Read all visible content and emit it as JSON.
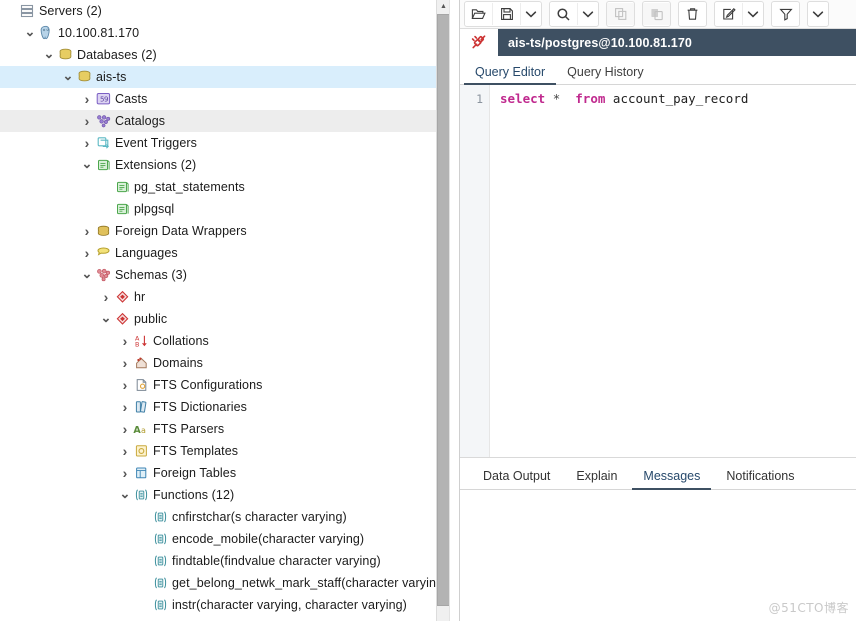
{
  "browser": {
    "scrollbar": {
      "up_arrow": "▲"
    },
    "tree": [
      {
        "label": "Servers (2)",
        "indent": 0,
        "twisty": "",
        "icon": "servers-icon",
        "state": "normal"
      },
      {
        "label": "10.100.81.170",
        "indent": 1,
        "twisty": "v",
        "icon": "postgres-server-icon",
        "state": "normal"
      },
      {
        "label": "Databases (2)",
        "indent": 2,
        "twisty": "v",
        "icon": "databases-icon",
        "state": "normal"
      },
      {
        "label": "ais-ts",
        "indent": 3,
        "twisty": "v",
        "icon": "database-icon",
        "state": "selected"
      },
      {
        "label": "Casts",
        "indent": 4,
        "twisty": ">",
        "icon": "casts-icon",
        "state": "normal"
      },
      {
        "label": "Catalogs",
        "indent": 4,
        "twisty": ">",
        "icon": "catalogs-icon",
        "state": "hover"
      },
      {
        "label": "Event Triggers",
        "indent": 4,
        "twisty": ">",
        "icon": "event-triggers-icon",
        "state": "normal"
      },
      {
        "label": "Extensions (2)",
        "indent": 4,
        "twisty": "v",
        "icon": "extensions-icon",
        "state": "normal"
      },
      {
        "label": "pg_stat_statements",
        "indent": 5,
        "twisty": "",
        "icon": "extension-icon",
        "state": "normal"
      },
      {
        "label": "plpgsql",
        "indent": 5,
        "twisty": "",
        "icon": "extension-icon",
        "state": "normal"
      },
      {
        "label": "Foreign Data Wrappers",
        "indent": 4,
        "twisty": ">",
        "icon": "foreign-data-wrappers-icon",
        "state": "normal"
      },
      {
        "label": "Languages",
        "indent": 4,
        "twisty": ">",
        "icon": "languages-icon",
        "state": "normal"
      },
      {
        "label": "Schemas (3)",
        "indent": 4,
        "twisty": "v",
        "icon": "schemas-icon",
        "state": "normal"
      },
      {
        "label": "hr",
        "indent": 5,
        "twisty": ">",
        "icon": "schema-icon",
        "state": "normal"
      },
      {
        "label": "public",
        "indent": 5,
        "twisty": "v",
        "icon": "schema-icon",
        "state": "normal"
      },
      {
        "label": "Collations",
        "indent": 6,
        "twisty": ">",
        "icon": "collations-icon",
        "state": "normal"
      },
      {
        "label": "Domains",
        "indent": 6,
        "twisty": ">",
        "icon": "domains-icon",
        "state": "normal"
      },
      {
        "label": "FTS Configurations",
        "indent": 6,
        "twisty": ">",
        "icon": "fts-configurations-icon",
        "state": "normal"
      },
      {
        "label": "FTS Dictionaries",
        "indent": 6,
        "twisty": ">",
        "icon": "fts-dictionaries-icon",
        "state": "normal"
      },
      {
        "label": "FTS Parsers",
        "indent": 6,
        "twisty": ">",
        "icon": "fts-parsers-icon",
        "state": "normal"
      },
      {
        "label": "FTS Templates",
        "indent": 6,
        "twisty": ">",
        "icon": "fts-templates-icon",
        "state": "normal"
      },
      {
        "label": "Foreign Tables",
        "indent": 6,
        "twisty": ">",
        "icon": "foreign-tables-icon",
        "state": "normal"
      },
      {
        "label": "Functions (12)",
        "indent": 6,
        "twisty": "v",
        "icon": "functions-icon",
        "state": "normal"
      },
      {
        "label": "cnfirstchar(s character varying)",
        "indent": 7,
        "twisty": "",
        "icon": "function-icon",
        "state": "normal"
      },
      {
        "label": "encode_mobile(character varying)",
        "indent": 7,
        "twisty": "",
        "icon": "function-icon",
        "state": "normal"
      },
      {
        "label": "findtable(findvalue character varying)",
        "indent": 7,
        "twisty": "",
        "icon": "function-icon",
        "state": "normal"
      },
      {
        "label": "get_belong_netwk_mark_staff(character varying)",
        "indent": 7,
        "twisty": "",
        "icon": "function-icon",
        "state": "normal"
      },
      {
        "label": "instr(character varying, character varying)",
        "indent": 7,
        "twisty": "",
        "icon": "function-icon",
        "state": "normal"
      }
    ]
  },
  "query": {
    "toolbar": [
      {
        "name": "open-file-button",
        "icon": "open-folder-icon",
        "enabled": true
      },
      {
        "name": "save-file-button",
        "icon": "save-icon",
        "enabled": true
      },
      {
        "name": "save-dropdown-button",
        "icon": "chevron-down-icon",
        "enabled": true
      },
      {
        "name": "find-button",
        "icon": "search-icon",
        "enabled": true
      },
      {
        "name": "find-dropdown-button",
        "icon": "chevron-down-icon",
        "enabled": true
      },
      {
        "name": "copy-button",
        "icon": "copy-icon",
        "enabled": false
      },
      {
        "name": "paste-button",
        "icon": "paste-icon",
        "enabled": false
      },
      {
        "name": "delete-button",
        "icon": "trash-icon",
        "enabled": true
      },
      {
        "name": "edit-button",
        "icon": "edit-pencil-icon",
        "enabled": true
      },
      {
        "name": "edit-dropdown-button",
        "icon": "chevron-down-icon",
        "enabled": true
      },
      {
        "name": "filter-button",
        "icon": "filter-icon",
        "enabled": true
      },
      {
        "name": "filter-dropdown-button",
        "icon": "chevron-down-icon",
        "enabled": true
      }
    ],
    "connection": {
      "icon": "disconnected-plug-icon",
      "title": "ais-ts/postgres@10.100.81.170"
    },
    "editor_tabs": [
      {
        "label": "Query Editor",
        "active": true
      },
      {
        "label": "Query History",
        "active": false
      }
    ],
    "sql": {
      "line_number": "1",
      "tokens": [
        {
          "text": "select",
          "type": "kw"
        },
        {
          "text": " ",
          "type": "op"
        },
        {
          "text": "*",
          "type": "op"
        },
        {
          "text": "  ",
          "type": "op"
        },
        {
          "text": "from",
          "type": "kw"
        },
        {
          "text": " ",
          "type": "op"
        },
        {
          "text": "account_pay_record",
          "type": "ident"
        }
      ]
    },
    "result_tabs": [
      {
        "label": "Data Output",
        "active": false
      },
      {
        "label": "Explain",
        "active": false
      },
      {
        "label": "Messages",
        "active": true
      },
      {
        "label": "Notifications",
        "active": false
      }
    ],
    "messages_content": ""
  },
  "watermark": "@51CTO博客",
  "colors": {
    "selection": "#d9eefc",
    "accent": "#3e5062",
    "keyword": "#c0298e",
    "green": "#4ca64c",
    "amber": "#d5b942",
    "red": "#cc3333",
    "purple": "#9a7fd4"
  }
}
